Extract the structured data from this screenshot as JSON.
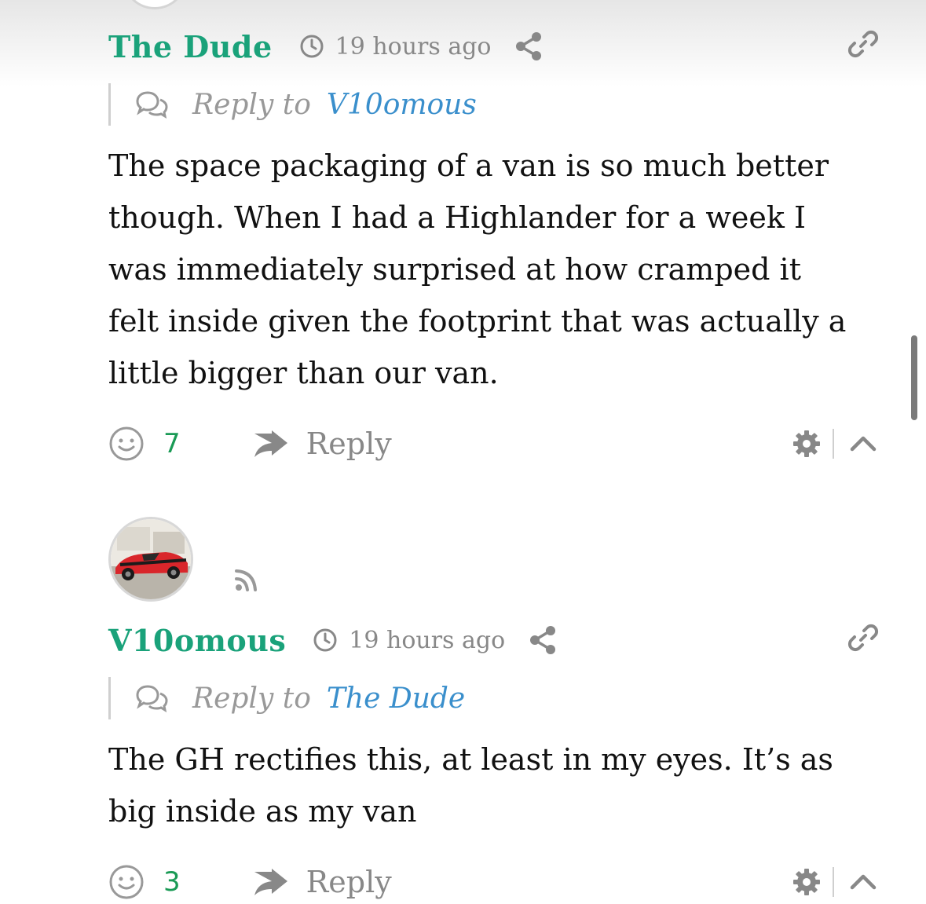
{
  "comments": [
    {
      "author": "The Dude",
      "time": "19 hours ago",
      "reply_prefix": "Reply to",
      "reply_to": "V10omous",
      "lines": [
        "The space packaging of a van is so much better",
        "though. When I had a Highlander for a week I",
        "was immediately surprised at how cramped it",
        "felt inside given the footprint that was actually a",
        "little bigger than our van."
      ],
      "votes": "7",
      "reply_label": "Reply"
    },
    {
      "author": "V10omous",
      "time": "19 hours ago",
      "reply_prefix": "Reply to",
      "reply_to": "The Dude",
      "lines": [
        "The GH rectifies this, at least in my eyes. It’s as",
        "big inside as my van"
      ],
      "votes": "3",
      "reply_label": "Reply"
    }
  ],
  "colors": {
    "author": "#1aa27a",
    "reply_to_link": "#3a8fcc",
    "votes": "#1a9a55",
    "muted": "#888888"
  },
  "icons": [
    "clock-icon",
    "share-icon",
    "link-icon",
    "reply-bubble-icon",
    "smiley-icon",
    "reply-arrow-icon",
    "gear-icon",
    "chevron-up-icon",
    "rss-icon"
  ]
}
